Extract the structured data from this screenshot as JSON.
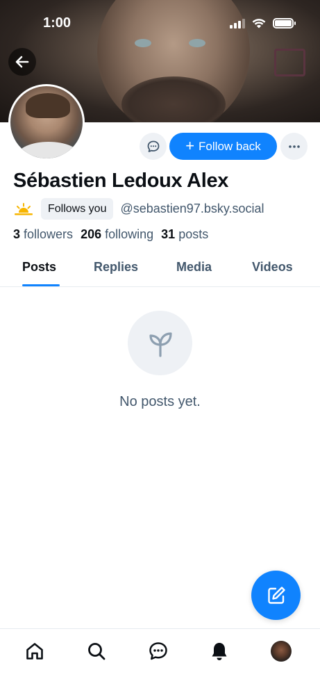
{
  "status_bar": {
    "time": "1:00"
  },
  "header": {
    "back_icon": "arrow-left-icon"
  },
  "profile": {
    "display_name": "Sébastien Ledoux Alex",
    "follows_you_label": "Follows you",
    "handle": "@sebastien97.bsky.social",
    "emoji_icon": "sunrise-icon",
    "stats": {
      "followers_count": "3",
      "followers_label": "followers",
      "following_count": "206",
      "following_label": "following",
      "posts_count": "31",
      "posts_label": "posts"
    }
  },
  "actions": {
    "message_icon": "chat-bubble-icon",
    "follow_back_label": "Follow back",
    "more_icon": "ellipsis-icon"
  },
  "tabs": [
    {
      "label": "Posts",
      "active": true
    },
    {
      "label": "Replies",
      "active": false
    },
    {
      "label": "Media",
      "active": false
    },
    {
      "label": "Videos",
      "active": false
    }
  ],
  "empty_state": {
    "icon": "sprout-icon",
    "text": "No posts yet."
  },
  "fab": {
    "icon": "compose-icon"
  },
  "bottom_nav": [
    {
      "icon": "home-icon"
    },
    {
      "icon": "search-icon"
    },
    {
      "icon": "messages-icon"
    },
    {
      "icon": "bell-icon"
    },
    {
      "icon": "profile-avatar-icon"
    }
  ],
  "colors": {
    "accent": "#1083fe",
    "muted_text": "#42576c",
    "chip_bg": "#eef1f5"
  }
}
